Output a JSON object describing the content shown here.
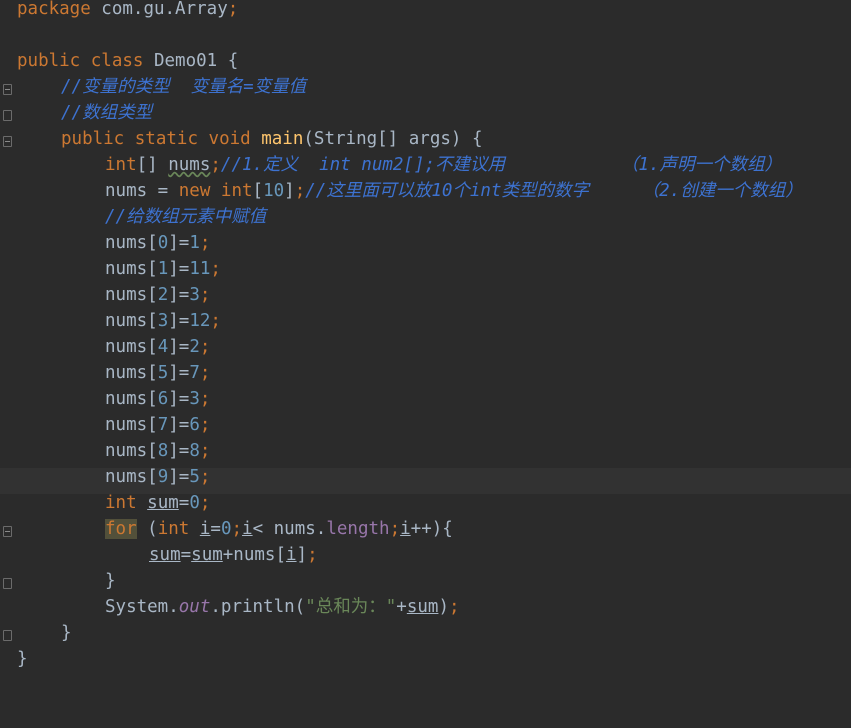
{
  "editor": {
    "language": "Java",
    "theme": "dark",
    "colors": {
      "background": "#2b2b2b",
      "keyword": "#cc7832",
      "comment": "#3d72d0",
      "number": "#6897bb",
      "method": "#ffc66d",
      "string": "#6a8759",
      "field": "#9876aa",
      "text": "#a9b7c6"
    },
    "lines": {
      "l1": {
        "kw": "package",
        "rest": " com.gu.Array",
        "semi": ";"
      },
      "l3": {
        "kw1": "public",
        "kw2": "class",
        "rest": " Demo01 {"
      },
      "l4": {
        "comment": "//变量的类型  变量名=变量值"
      },
      "l5": {
        "comment": "//数组类型"
      },
      "l6": {
        "kw1": "public",
        "kw2": "static",
        "kw3": "void",
        "method": "main",
        "rest": "(String[] args) {"
      },
      "l7": {
        "kw": "int",
        "brackets": "[] ",
        "var": "nums",
        "semi": ";",
        "comment": "//1.定义  int num2[];不建议用           （1.声明一个数组）"
      },
      "l8": {
        "pre": "nums = ",
        "kw1": "new",
        "sp": " ",
        "kw2": "int",
        "open": "[",
        "num": "10",
        "close": "]",
        "semi": ";",
        "comment": "//这里面可以放10个int类型的数字     （2.创建一个数组）"
      },
      "l9": {
        "comment": "//给数组元素中赋值"
      },
      "assignments": [
        {
          "pre": "nums[",
          "idx": "0",
          "mid": "]=",
          "val": "1"
        },
        {
          "pre": "nums[",
          "idx": "1",
          "mid": "]=",
          "val": "11"
        },
        {
          "pre": "nums[",
          "idx": "2",
          "mid": "]=",
          "val": "3"
        },
        {
          "pre": "nums[",
          "idx": "3",
          "mid": "]=",
          "val": "12"
        },
        {
          "pre": "nums[",
          "idx": "4",
          "mid": "]=",
          "val": "2"
        },
        {
          "pre": "nums[",
          "idx": "5",
          "mid": "]=",
          "val": "7"
        },
        {
          "pre": "nums[",
          "idx": "6",
          "mid": "]=",
          "val": "3"
        },
        {
          "pre": "nums[",
          "idx": "7",
          "mid": "]=",
          "val": "6"
        },
        {
          "pre": "nums[",
          "idx": "8",
          "mid": "]=",
          "val": "8"
        },
        {
          "pre": "nums[",
          "idx": "9",
          "mid": "]=",
          "val": "5"
        }
      ],
      "l20": {
        "kw": "int",
        "var": "sum",
        "eq": "=",
        "num": "0",
        "semi": ";"
      },
      "l21": {
        "kw1": "for",
        "p1": " (",
        "kw2": "int",
        "sp": " ",
        "v1": "i",
        "eq": "=",
        "num": "0",
        "s1": ";",
        "v2": "i",
        "lt": "< nums.",
        "fld": "length",
        "s2": ";",
        "v3": "i",
        "end": "++){"
      },
      "l22": {
        "v1": "sum",
        "eq": "=",
        "v2": "sum",
        "plus": "+nums[",
        "v3": "i",
        "close": "]",
        "semi": ";"
      },
      "l23": {
        "text": "}"
      },
      "l24": {
        "pre": "System.",
        "sfld": "out",
        "mid": ".println(",
        "str": "\"总和为：\"",
        "plus": "+",
        "var": "sum",
        "close": ")",
        "semi": ";"
      },
      "l25": {
        "text": "}"
      },
      "l26": {
        "text": "}"
      }
    }
  }
}
